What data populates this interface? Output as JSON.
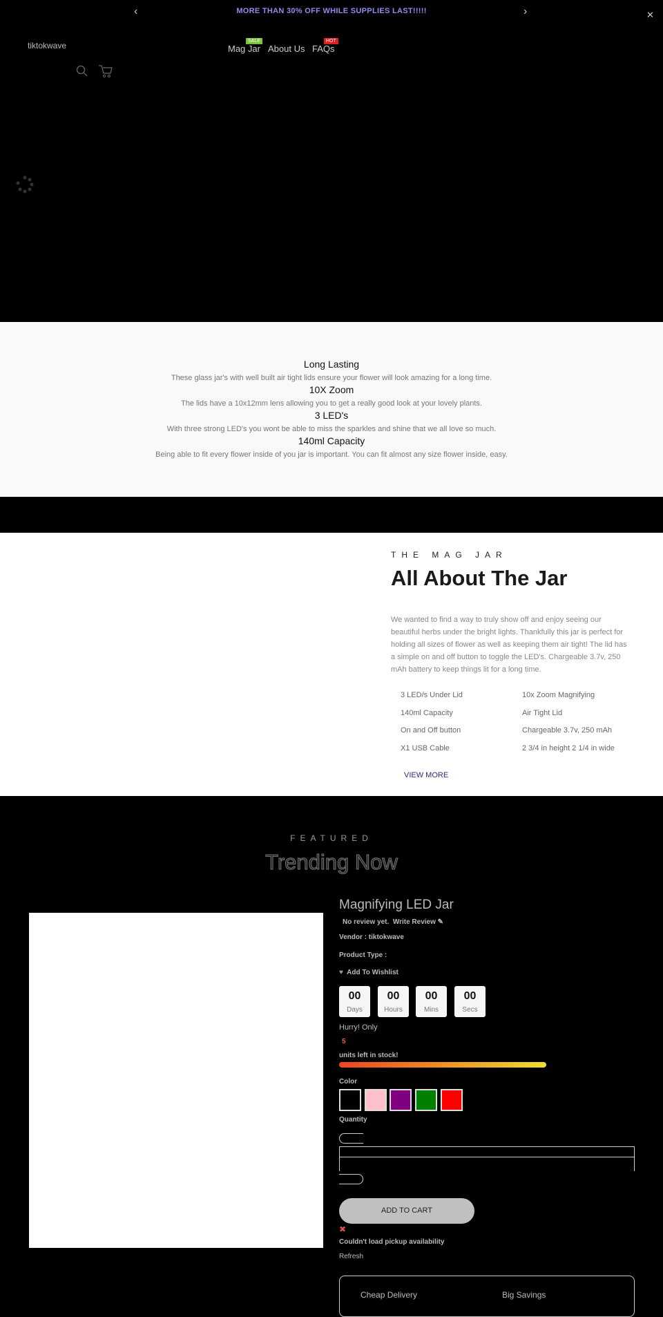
{
  "announcement": {
    "text": "MORE THAN 30% OFF WHILE SUPPLIES LAST!!!!!"
  },
  "header": {
    "logo": "tiktokwave",
    "nav": [
      {
        "label": "Mag Jar",
        "badge": "SALE",
        "badge_color": "#7dc33a"
      },
      {
        "label": "About Us"
      },
      {
        "label": "FAQs",
        "badge": "HOT",
        "badge_color": "#e02020"
      }
    ]
  },
  "features": [
    {
      "title": "Long Lasting",
      "text": "These glass jar's with well built air tight lids ensure your flower will look amazing for a long time."
    },
    {
      "title": "10X Zoom",
      "text": "The lids have a 10x12mm lens allowing you to get a really good look at your lovely plants."
    },
    {
      "title": "3 LED's",
      "text": "With three strong LED's you wont be able to miss the sparkles and shine that we all love so much."
    },
    {
      "title": "140ml Capacity",
      "text": "Being able to fit every flower inside of you jar is important. You can fit almost any size flower inside, easy."
    }
  ],
  "about": {
    "eyebrow": "THE MAG JAR",
    "title": "All About The Jar",
    "body": "We wanted to find a way to truly show off and enjoy seeing our beautiful herbs under the bright lights. Thankfully this jar is perfect for holding all sizes of flower as well as keeping them air tight! The lid has a simple on and off button to toggle the LED's. Chargeable 3.7v, 250 mAh battery to keep things lit for a long time.",
    "specs": [
      "3 LED/s Under Lid",
      "10x Zoom Magnifying",
      "140ml Capacity",
      "Air Tight Lid",
      "On and Off button",
      "Chargeable 3.7v, 250 mAh",
      "X1 USB Cable",
      "2 3/4 in height 2 1/4 in wide"
    ],
    "view_more": "VIEW MORE"
  },
  "featured": {
    "eyebrow": "FEATURED",
    "title": "Trending Now"
  },
  "product": {
    "title": "Magnifying LED Jar",
    "reviews": "No review yet.",
    "write_review": "Write Review",
    "vendor": "Vendor : tiktokwave",
    "type": "Product Type :",
    "wishlist": "Add To Wishlist",
    "countdown": [
      {
        "v": "00",
        "l": "Days"
      },
      {
        "v": "00",
        "l": "Hours"
      },
      {
        "v": "00",
        "l": "Mins"
      },
      {
        "v": "00",
        "l": "Secs"
      }
    ],
    "hurry": "Hurry! Only",
    "stock": "5",
    "stock_suffix": "units left in stock!",
    "color_label": "Color",
    "colors": [
      "#000000",
      "#ffc0cb",
      "#800080",
      "#008000",
      "#ff0000"
    ],
    "quantity_label": "Quantity",
    "add_to_cart": "ADD TO CART",
    "pickup_error": "Couldn't load pickup availability",
    "refresh": "Refresh",
    "perks": [
      "Cheap Delivery",
      "Big Savings"
    ]
  }
}
